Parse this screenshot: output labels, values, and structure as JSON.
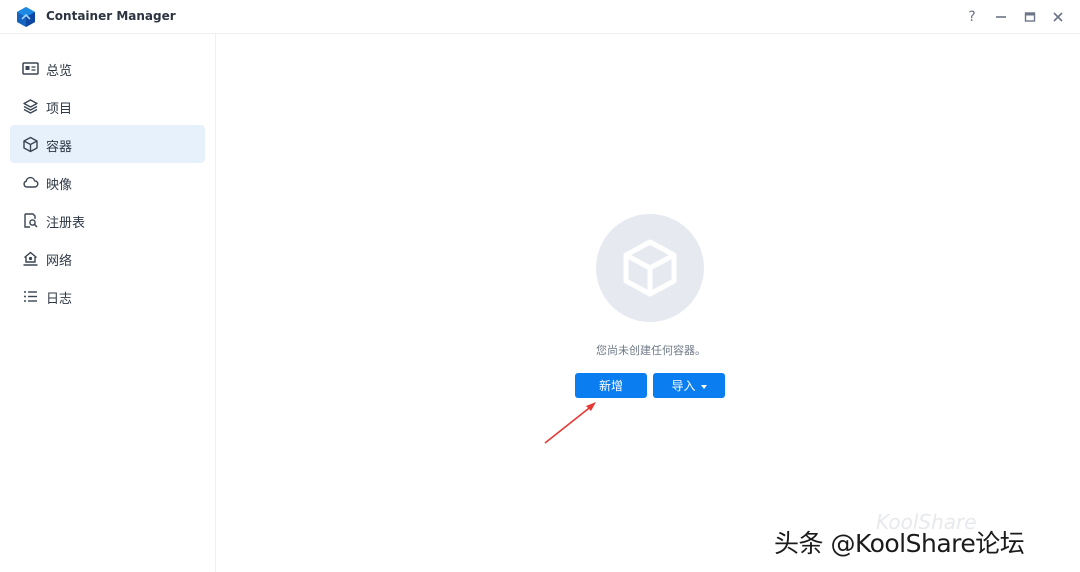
{
  "window": {
    "title": "Container Manager",
    "help_glyph": "?",
    "min_glyph": "—",
    "max_glyph": "▭",
    "close_glyph": "✕"
  },
  "sidebar": {
    "items": [
      {
        "label": "总览",
        "icon": "overview-card-icon",
        "active": false
      },
      {
        "label": "项目",
        "icon": "layers-icon",
        "active": false
      },
      {
        "label": "容器",
        "icon": "container-cube-icon",
        "active": true
      },
      {
        "label": "映像",
        "icon": "cloud-icon",
        "active": false
      },
      {
        "label": "注册表",
        "icon": "registry-search-icon",
        "active": false
      },
      {
        "label": "网络",
        "icon": "network-home-icon",
        "active": false
      },
      {
        "label": "日志",
        "icon": "list-icon",
        "active": false
      }
    ]
  },
  "main": {
    "empty_message": "您尚未创建任何容器。",
    "new_button": "新增",
    "import_button": "导入"
  },
  "watermark": {
    "faint_text": "KoolShare",
    "text": "头条 @KoolShare论坛"
  },
  "colors": {
    "accent": "#0a7ef0",
    "active_bg": "#e7f1fc",
    "annotation_arrow": "#e53935"
  }
}
